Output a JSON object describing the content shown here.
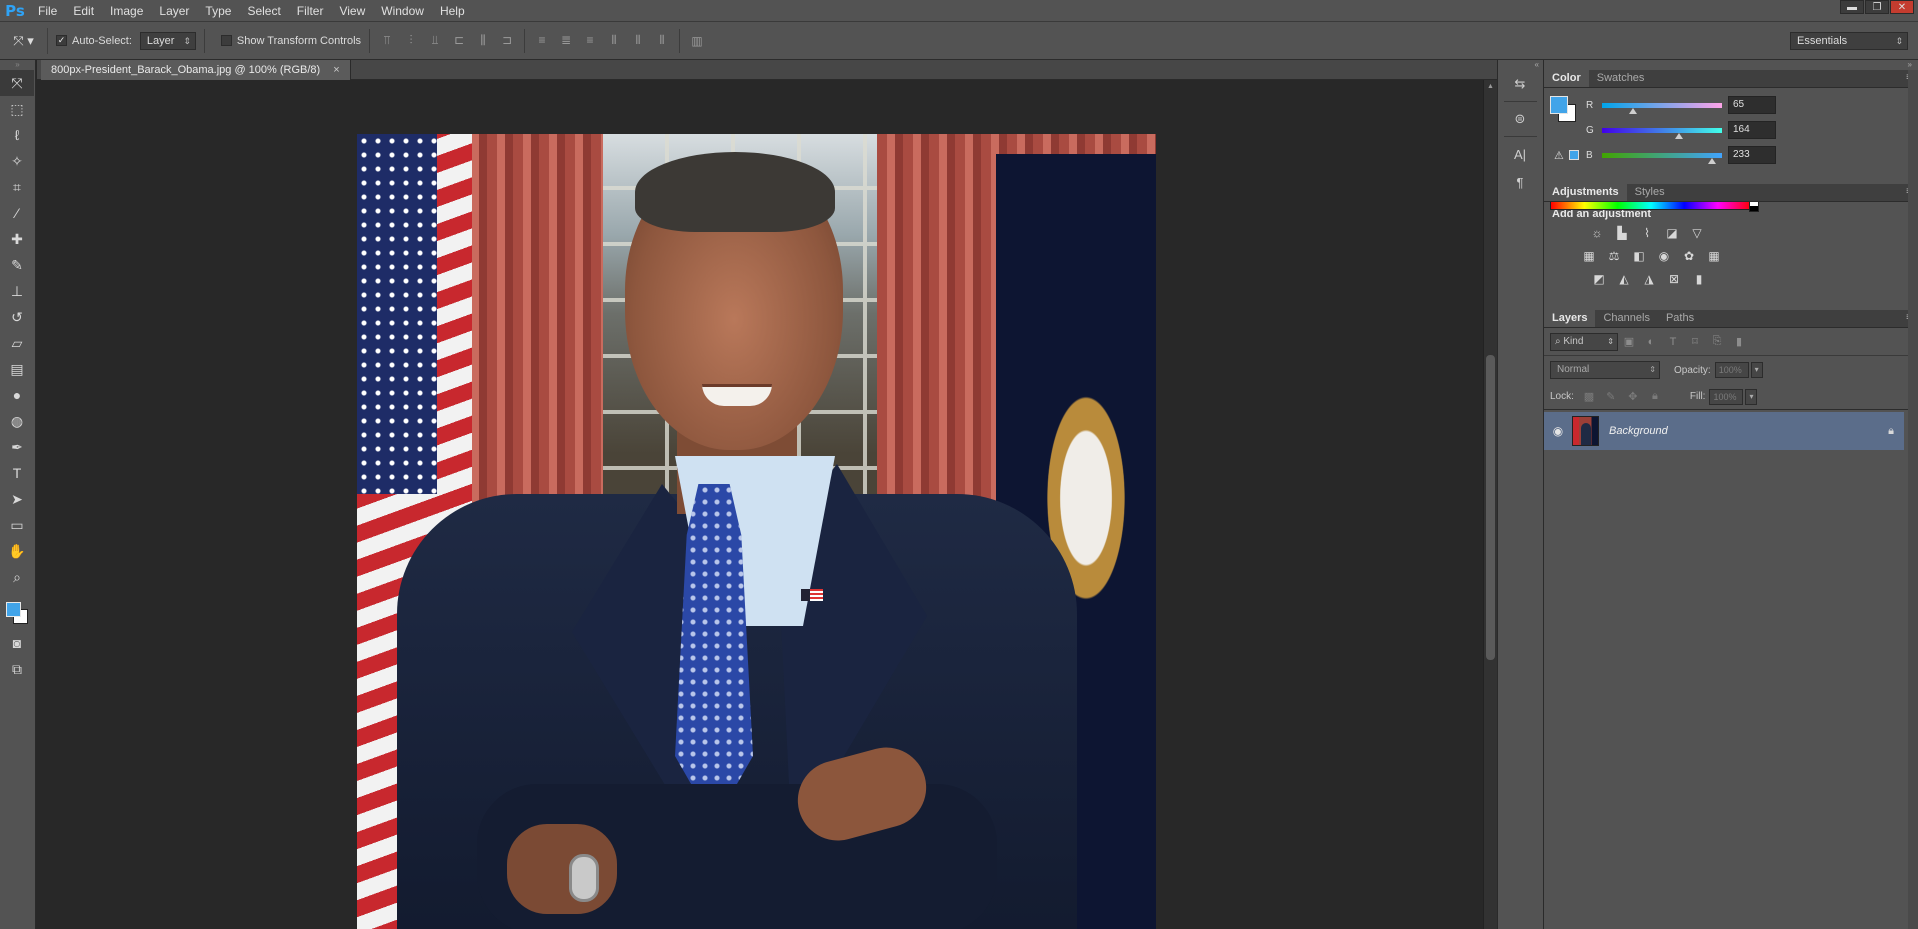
{
  "app": {
    "logo": "Ps"
  },
  "menu": [
    "File",
    "Edit",
    "Image",
    "Layer",
    "Type",
    "Select",
    "Filter",
    "View",
    "Window",
    "Help"
  ],
  "window_controls": {
    "minimize": "▬",
    "restore": "❐",
    "close": "✕"
  },
  "options": {
    "tool_icon": "move-tool-icon",
    "auto_select_label": "Auto-Select:",
    "auto_select_checked": true,
    "auto_select_value": "Layer",
    "transform_label": "Show Transform Controls",
    "transform_checked": false,
    "workspace": "Essentials"
  },
  "document": {
    "tab_title": "800px-President_Barack_Obama.jpg @ 100% (RGB/8)",
    "close_glyph": "×"
  },
  "tools": [
    "move-tool-icon",
    "marquee-tool-icon",
    "lasso-tool-icon",
    "magic-wand-icon",
    "crop-tool-icon",
    "eyedropper-icon",
    "healing-brush-icon",
    "brush-tool-icon",
    "clone-stamp-icon",
    "history-brush-icon",
    "eraser-icon",
    "gradient-tool-icon",
    "blur-tool-icon",
    "dodge-tool-icon",
    "pen-tool-icon",
    "type-tool-icon",
    "path-selection-icon",
    "shape-tool-icon",
    "hand-tool-icon",
    "zoom-tool-icon"
  ],
  "colors": {
    "foreground": "#41a4e9",
    "background": "#ffffff",
    "accent": "#5b6d8a"
  },
  "color_panel": {
    "tabs": [
      "Color",
      "Swatches"
    ],
    "active_tab": "Color",
    "channels": [
      {
        "label": "R",
        "value": "65",
        "fraction": 0.255
      },
      {
        "label": "G",
        "value": "164",
        "fraction": 0.643
      },
      {
        "label": "B",
        "value": "233",
        "fraction": 0.914
      }
    ]
  },
  "adjustments_panel": {
    "tabs": [
      "Adjustments",
      "Styles"
    ],
    "active_tab": "Adjustments",
    "title": "Add an adjustment",
    "rows": [
      [
        "brightness-icon",
        "levels-icon",
        "curves-icon",
        "exposure-icon",
        "vibrance-icon"
      ],
      [
        "hue-saturation-icon",
        "color-balance-icon",
        "black-white-icon",
        "photo-filter-icon",
        "channel-mixer-icon",
        "color-lookup-icon"
      ],
      [
        "invert-icon",
        "posterize-icon",
        "threshold-icon",
        "selective-color-icon",
        "gradient-map-icon"
      ]
    ]
  },
  "layers_panel": {
    "tabs": [
      "Layers",
      "Channels",
      "Paths"
    ],
    "active_tab": "Layers",
    "kind_label": "Kind",
    "blend_mode": "Normal",
    "opacity_label": "Opacity:",
    "opacity_value": "100%",
    "lock_label": "Lock:",
    "fill_label": "Fill:",
    "fill_value": "100%",
    "layers": [
      {
        "name": "Background",
        "visible": true,
        "locked": true
      }
    ]
  }
}
